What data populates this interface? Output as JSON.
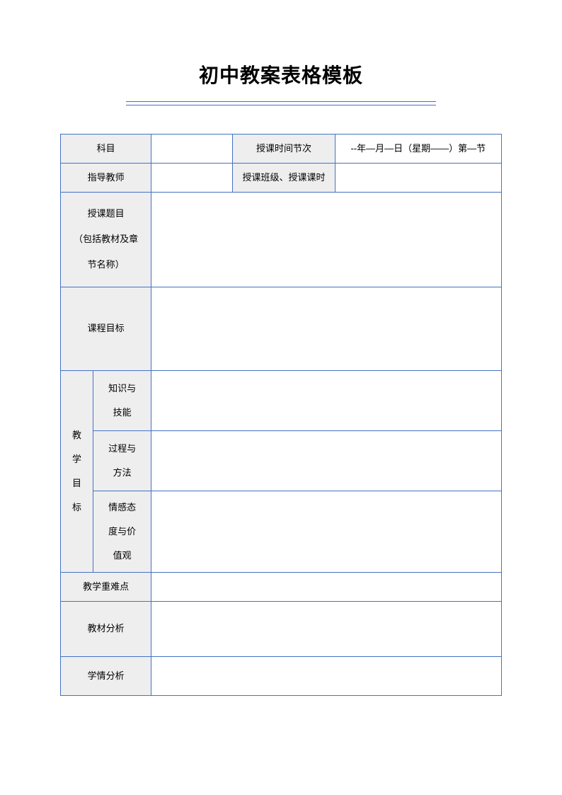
{
  "title": "初中教案表格模板",
  "labels": {
    "subject": "科目",
    "teachTime": "授课时间节次",
    "dateValue": "--年—月—日（星期——）第—节",
    "instructor": "指导教师",
    "classHours": "授课班级、授课课时",
    "topicLine1": "授课题目",
    "topicLine2": "（包括教材及章",
    "topicLine3": "节名称）",
    "courseGoal": "课程目标",
    "teachingGoalChar1": "教",
    "teachingGoalChar2": "学",
    "teachingGoalChar3": "目",
    "teachingGoalChar4": "标",
    "knowledge1": "知识与",
    "knowledge2": "技能",
    "process1": "过程与",
    "process2": "方法",
    "emotion1": "情感态",
    "emotion2": "度与价",
    "emotion3": "值观",
    "keyDifficult": "教学重难点",
    "materialAnalysis": "教材分析",
    "situationAnalysis": "学情分析"
  }
}
